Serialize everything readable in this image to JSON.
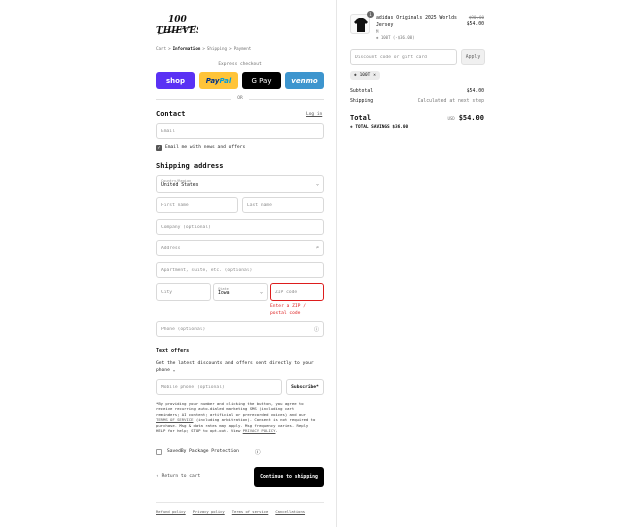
{
  "brand": {
    "logo_text": "100 THIEVES"
  },
  "breadcrumb": [
    "Cart",
    "Information",
    "Shipping",
    "Payment"
  ],
  "breadcrumb_separator": ">",
  "express": {
    "label": "Express checkout",
    "shop": "shop",
    "paypal_a": "Pay",
    "paypal_b": "Pal",
    "gpay": "G Pay",
    "venmo": "venmo",
    "or": "OR"
  },
  "contact": {
    "heading": "Contact",
    "login": "Log in",
    "email_placeholder": "Email",
    "news_label": "Email me with news and offers",
    "news_checked": true
  },
  "shipping": {
    "heading": "Shipping address",
    "country_label": "Country/Region",
    "country_value": "United States",
    "first_name": "First name",
    "last_name": "Last name",
    "company": "Company (optional)",
    "address": "Address",
    "apartment": "Apartment, suite, etc. (optional)",
    "city": "City",
    "state_label": "State",
    "state_value": "Iowa",
    "zip": "ZIP code",
    "zip_error": "Enter a ZIP / postal code",
    "phone": "Phone (optional)"
  },
  "text_offers": {
    "heading": "Text offers",
    "description": "Get the latest discounts and offers sent directly to your phone",
    "mobile_placeholder": "Mobile phone (optional)",
    "subscribe": "Subscribe*",
    "legal_1": "*By providing your number and clicking the button, you agree to",
    "legal_2": "receive recurring auto-dialed marketing SMS (including cart",
    "legal_3": "reminders; AI content; artificial or prerecorded voices) and our",
    "legal_4a": "TERMS OF SERVICE",
    "legal_4b": " (including arbitration). Consent is not required to",
    "legal_5": "purchase. Msg & data rates may apply. Msg frequency varies. Reply",
    "legal_6a": "HELP for help; STOP to opt-out. View ",
    "legal_6b": "PRIVACY POLICY",
    "legal_6c": "."
  },
  "savedby": {
    "label": "SavedBy Package Protection",
    "checked": false
  },
  "actions": {
    "return": "Return to cart",
    "continue": "Continue to shipping"
  },
  "footer": [
    "Refund policy",
    "Privacy policy",
    "Terms of service",
    "Cancellations"
  ],
  "order": {
    "item_name_1": "adidas Originals 2025 Worlds",
    "item_name_2": "Jersey",
    "item_variant": "M",
    "item_discount": "100T (-$36.00)",
    "item_qty": "1",
    "item_original_price": "$90.00",
    "item_price": "$54.00",
    "discount_placeholder": "Discount code or gift card",
    "apply": "Apply",
    "applied_code": "100T",
    "subtotal_label": "Subtotal",
    "subtotal_value": "$54.00",
    "shipping_label": "Shipping",
    "shipping_value": "Calculated at next step",
    "total_label": "Total",
    "currency": "USD",
    "total_value": "$54.00",
    "savings_label": "TOTAL SAVINGS",
    "savings_value": "$36.00"
  },
  "colors": {
    "shop": "#5a31f4",
    "paypal": "#ffc439",
    "gpay": "#000000",
    "venmo": "#3d95ce",
    "error": "#dd1d1d",
    "primary": "#000000"
  }
}
